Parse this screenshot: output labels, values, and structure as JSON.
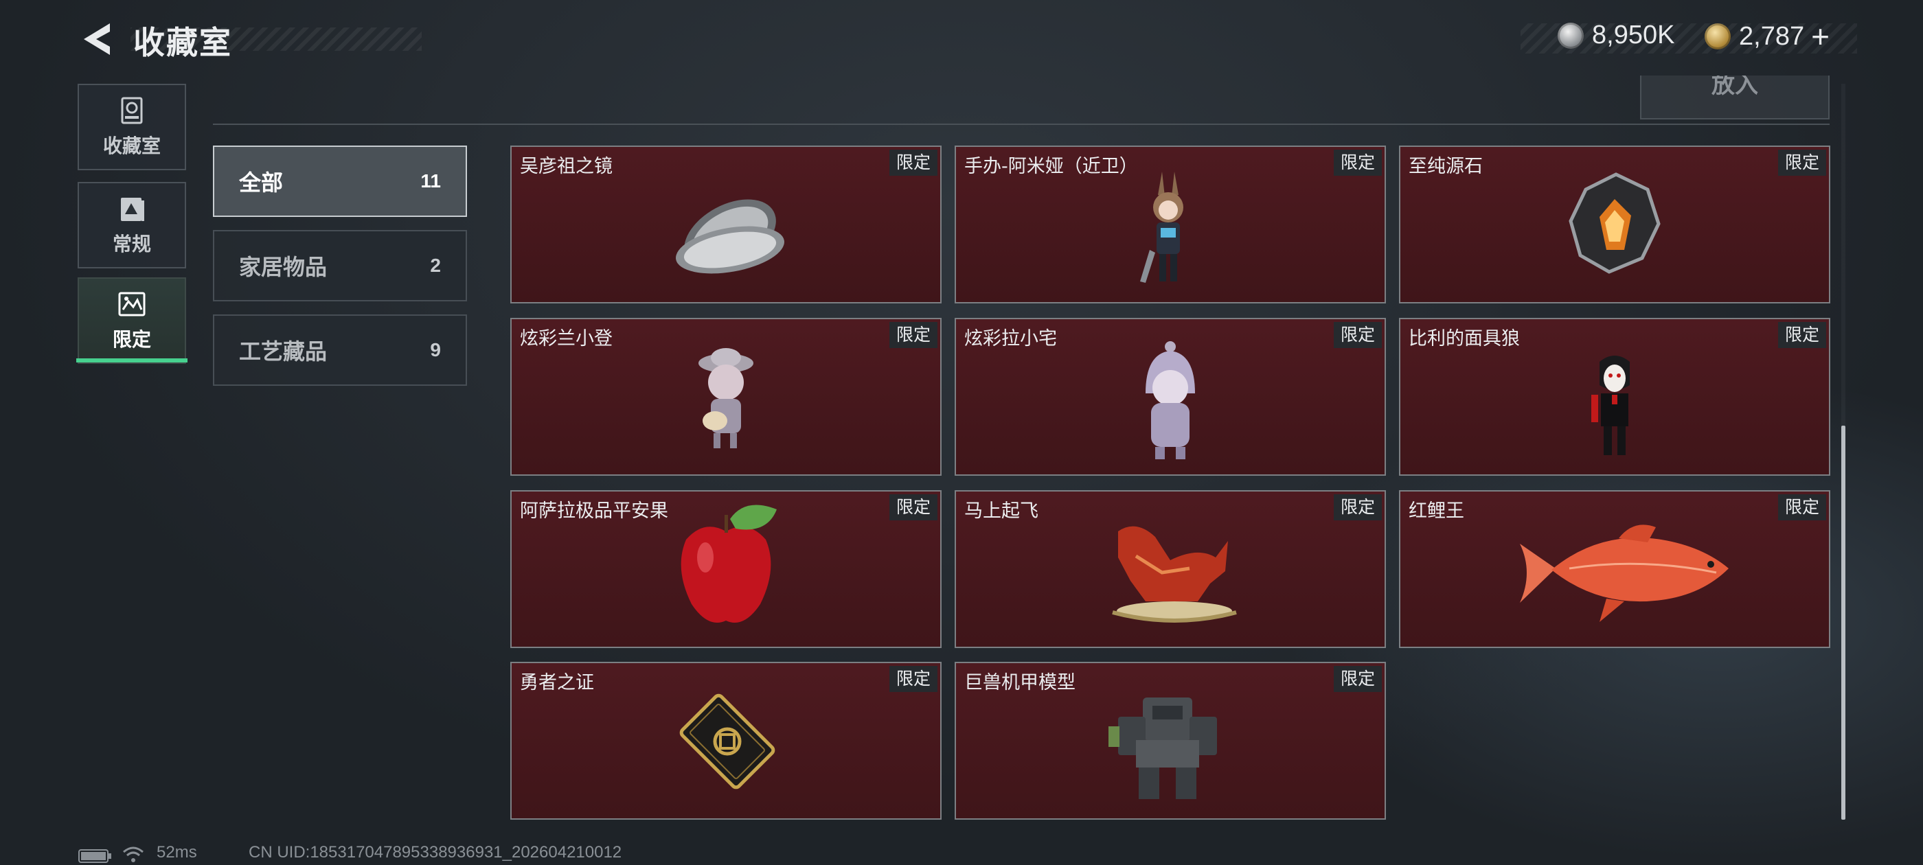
{
  "header": {
    "title": "收藏室",
    "currency_silver": "8,950K",
    "currency_gold": "2,787",
    "plus_label": "+"
  },
  "nav": [
    {
      "label": "收藏室",
      "icon": "collection-room-icon"
    },
    {
      "label": "常规",
      "icon": "regular-icon"
    },
    {
      "label": "限定",
      "icon": "limited-icon",
      "active": true
    }
  ],
  "categories": [
    {
      "label": "全部",
      "count": "11",
      "active": true
    },
    {
      "label": "家居物品",
      "count": "2"
    },
    {
      "label": "工艺藏品",
      "count": "9"
    }
  ],
  "place_button": "放入",
  "items": [
    {
      "name": "吴彦祖之镜",
      "badge": "限定",
      "icon": "mirror-icon"
    },
    {
      "name": "手办-阿米娅（近卫）",
      "badge": "限定",
      "icon": "figure-amiya-icon"
    },
    {
      "name": "至纯源石",
      "badge": "限定",
      "icon": "originium-crystal-icon"
    },
    {
      "name": "炫彩兰小登",
      "badge": "限定",
      "icon": "guitar-figure-icon"
    },
    {
      "name": "炫彩拉小宅",
      "badge": "限定",
      "icon": "hooded-figure-icon"
    },
    {
      "name": "比利的面具狼",
      "badge": "限定",
      "icon": "billy-puppet-icon"
    },
    {
      "name": "阿萨拉极品平安果",
      "badge": "限定",
      "icon": "apple-icon"
    },
    {
      "name": "马上起飞",
      "badge": "限定",
      "icon": "horse-statue-icon"
    },
    {
      "name": "红鲤王",
      "badge": "限定",
      "icon": "carp-icon"
    },
    {
      "name": "勇者之证",
      "badge": "限定",
      "icon": "card-emblem-icon"
    },
    {
      "name": "巨兽机甲模型",
      "badge": "限定",
      "icon": "mech-model-icon"
    }
  ],
  "status": {
    "ping": "52ms",
    "uid": "CN UID:185317047895338936931_202604210012"
  }
}
